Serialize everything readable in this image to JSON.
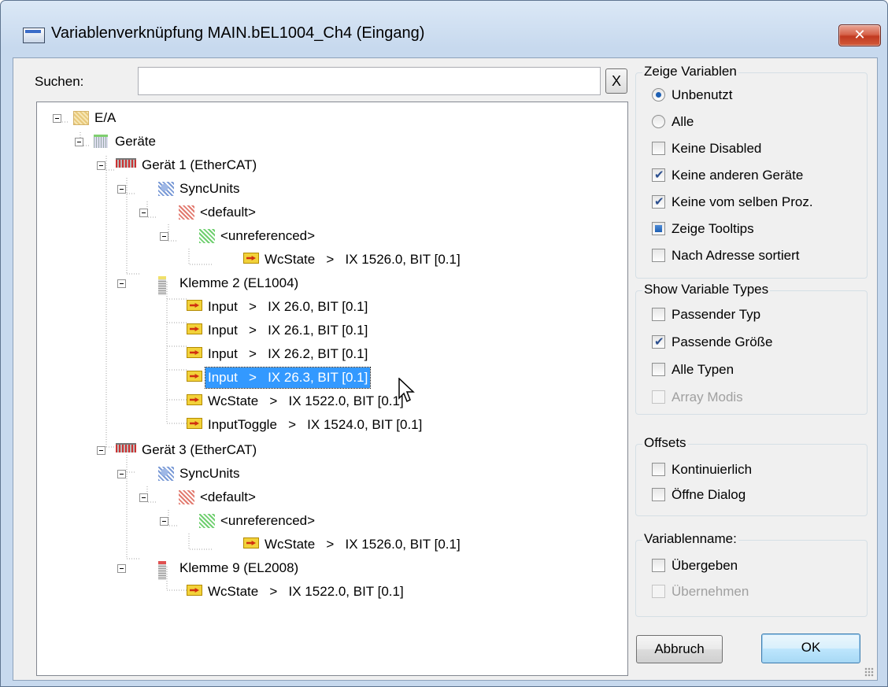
{
  "window": {
    "title": "Variablenverknüpfung MAIN.bEL1004_Ch4 (Eingang)",
    "close_glyph": "✕",
    "colors": {
      "close": "#c13a20",
      "selection": "#3399ff",
      "frame": "#c7d9ee"
    }
  },
  "search": {
    "label": "Suchen:",
    "value": "",
    "placeholder": "",
    "clear_label": "X"
  },
  "tree": {
    "nodes": [
      {
        "label": "E/A",
        "icon": "folder-icon"
      },
      {
        "label": "Geräte",
        "icon": "devices-icon"
      },
      {
        "label": "Gerät 1 (EtherCAT)",
        "icon": "ethercat-icon"
      },
      {
        "label": "SyncUnits",
        "icon": "sync-units-icon"
      },
      {
        "label": "<default>",
        "icon": "sync-default-icon"
      },
      {
        "label": "<unreferenced>",
        "icon": "sync-unreferenced-icon"
      },
      {
        "label": "WcState   >   IX 1526.0, BIT [0.1]",
        "icon": "variable-icon"
      },
      {
        "label": "Klemme 2 (EL1004)",
        "icon": "terminal-icon"
      },
      {
        "label": "Input   >   IX 26.0, BIT [0.1]",
        "icon": "variable-icon"
      },
      {
        "label": "Input   >   IX 26.1, BIT [0.1]",
        "icon": "variable-icon"
      },
      {
        "label": "Input   >   IX 26.2, BIT [0.1]",
        "icon": "variable-icon"
      },
      {
        "label": "Input   >   IX 26.3, BIT [0.1]",
        "icon": "variable-icon",
        "selected": true
      },
      {
        "label": "WcState   >   IX 1522.0, BIT [0.1]",
        "icon": "variable-icon"
      },
      {
        "label": "InputToggle   >   IX 1524.0, BIT [0.1]",
        "icon": "variable-icon"
      },
      {
        "label": "Gerät 3 (EtherCAT)",
        "icon": "ethercat-icon"
      },
      {
        "label": "SyncUnits",
        "icon": "sync-units-icon"
      },
      {
        "label": "<default>",
        "icon": "sync-default-icon"
      },
      {
        "label": "<unreferenced>",
        "icon": "sync-unreferenced-icon"
      },
      {
        "label": "WcState   >   IX 1526.0, BIT [0.1]",
        "icon": "variable-icon"
      },
      {
        "label": "Klemme 9 (EL2008)",
        "icon": "terminal-icon"
      },
      {
        "label": "WcState   >   IX 1522.0, BIT [0.1]",
        "icon": "variable-icon"
      }
    ]
  },
  "show_variables": {
    "title": "Zeige Variablen",
    "options": [
      {
        "label": "Unbenutzt",
        "type": "radio",
        "state": "checked"
      },
      {
        "label": "Alle",
        "type": "radio",
        "state": "unchecked"
      },
      {
        "label": "Keine Disabled",
        "type": "checkbox",
        "state": "unchecked"
      },
      {
        "label": "Keine anderen Geräte",
        "type": "checkbox",
        "state": "checked"
      },
      {
        "label": "Keine vom selben Proz.",
        "type": "checkbox",
        "state": "checked"
      },
      {
        "label": "Zeige Tooltips",
        "type": "checkbox",
        "state": "indeterminate"
      },
      {
        "label": "Nach Adresse sortiert",
        "type": "checkbox",
        "state": "unchecked"
      }
    ]
  },
  "show_types": {
    "title": "Show Variable Types",
    "options": [
      {
        "label": "Passender Typ",
        "state": "unchecked"
      },
      {
        "label": "Passende Größe",
        "state": "checked"
      },
      {
        "label": "Alle Typen",
        "state": "unchecked"
      },
      {
        "label": "Array Modis",
        "state": "disabled"
      }
    ]
  },
  "offsets": {
    "title": "Offsets",
    "options": [
      {
        "label": "Kontinuierlich",
        "state": "unchecked"
      },
      {
        "label": "Öffne Dialog",
        "state": "unchecked"
      }
    ]
  },
  "variable_name": {
    "title": "Variablenname:",
    "options": [
      {
        "label": "Übergeben",
        "state": "unchecked"
      },
      {
        "label": "Übernehmen",
        "state": "disabled"
      }
    ]
  },
  "buttons": {
    "cancel": "Abbruch",
    "ok": "OK"
  }
}
